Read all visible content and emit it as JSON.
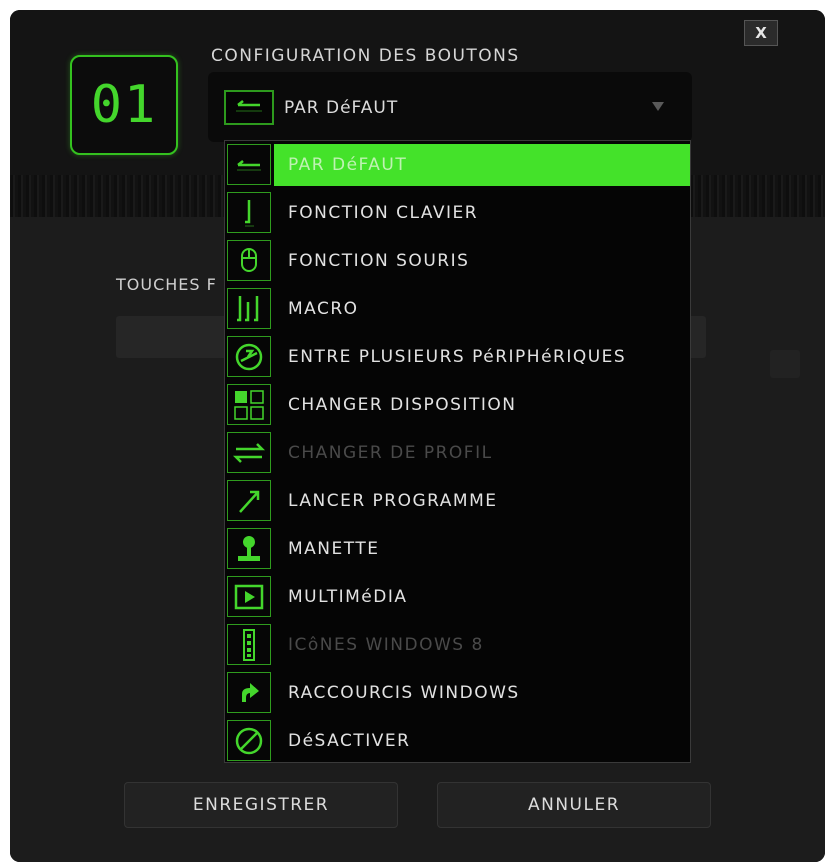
{
  "dialog": {
    "close_label": "X",
    "button_number": "01",
    "title": "CONFIGURATION DES BOUTONS",
    "selected_value": "PAR DéFAUT",
    "section_label": "TOUCHES F",
    "accent_color": "#44d62c"
  },
  "menu": {
    "items": [
      {
        "label": "PAR DéFAUT",
        "icon": "default-arrow-icon",
        "state": "selected"
      },
      {
        "label": "FONCTION CLAVIER",
        "icon": "keyboard-function-icon",
        "state": "normal"
      },
      {
        "label": "FONCTION SOURIS",
        "icon": "mouse-icon",
        "state": "normal"
      },
      {
        "label": "MACRO",
        "icon": "macro-icon",
        "state": "normal"
      },
      {
        "label": "ENTRE PLUSIEURS PéRIPHéRIQUES",
        "icon": "inter-device-icon",
        "state": "normal"
      },
      {
        "label": "CHANGER DISPOSITION",
        "icon": "layout-grid-icon",
        "state": "normal"
      },
      {
        "label": "CHANGER DE PROFIL",
        "icon": "switch-profile-icon",
        "state": "disabled"
      },
      {
        "label": "LANCER PROGRAMME",
        "icon": "launch-program-icon",
        "state": "normal"
      },
      {
        "label": "MANETTE",
        "icon": "joystick-icon",
        "state": "normal"
      },
      {
        "label": "MULTIMéDIA",
        "icon": "multimedia-play-icon",
        "state": "normal"
      },
      {
        "label": "ICôNES WINDOWS 8",
        "icon": "windows8-charms-icon",
        "state": "disabled"
      },
      {
        "label": "RACCOURCIS WINDOWS",
        "icon": "windows-shortcut-icon",
        "state": "normal"
      },
      {
        "label": "DéSACTIVER",
        "icon": "disable-icon",
        "state": "normal"
      }
    ]
  },
  "footer": {
    "save_label": "ENREGISTRER",
    "cancel_label": "ANNULER"
  }
}
